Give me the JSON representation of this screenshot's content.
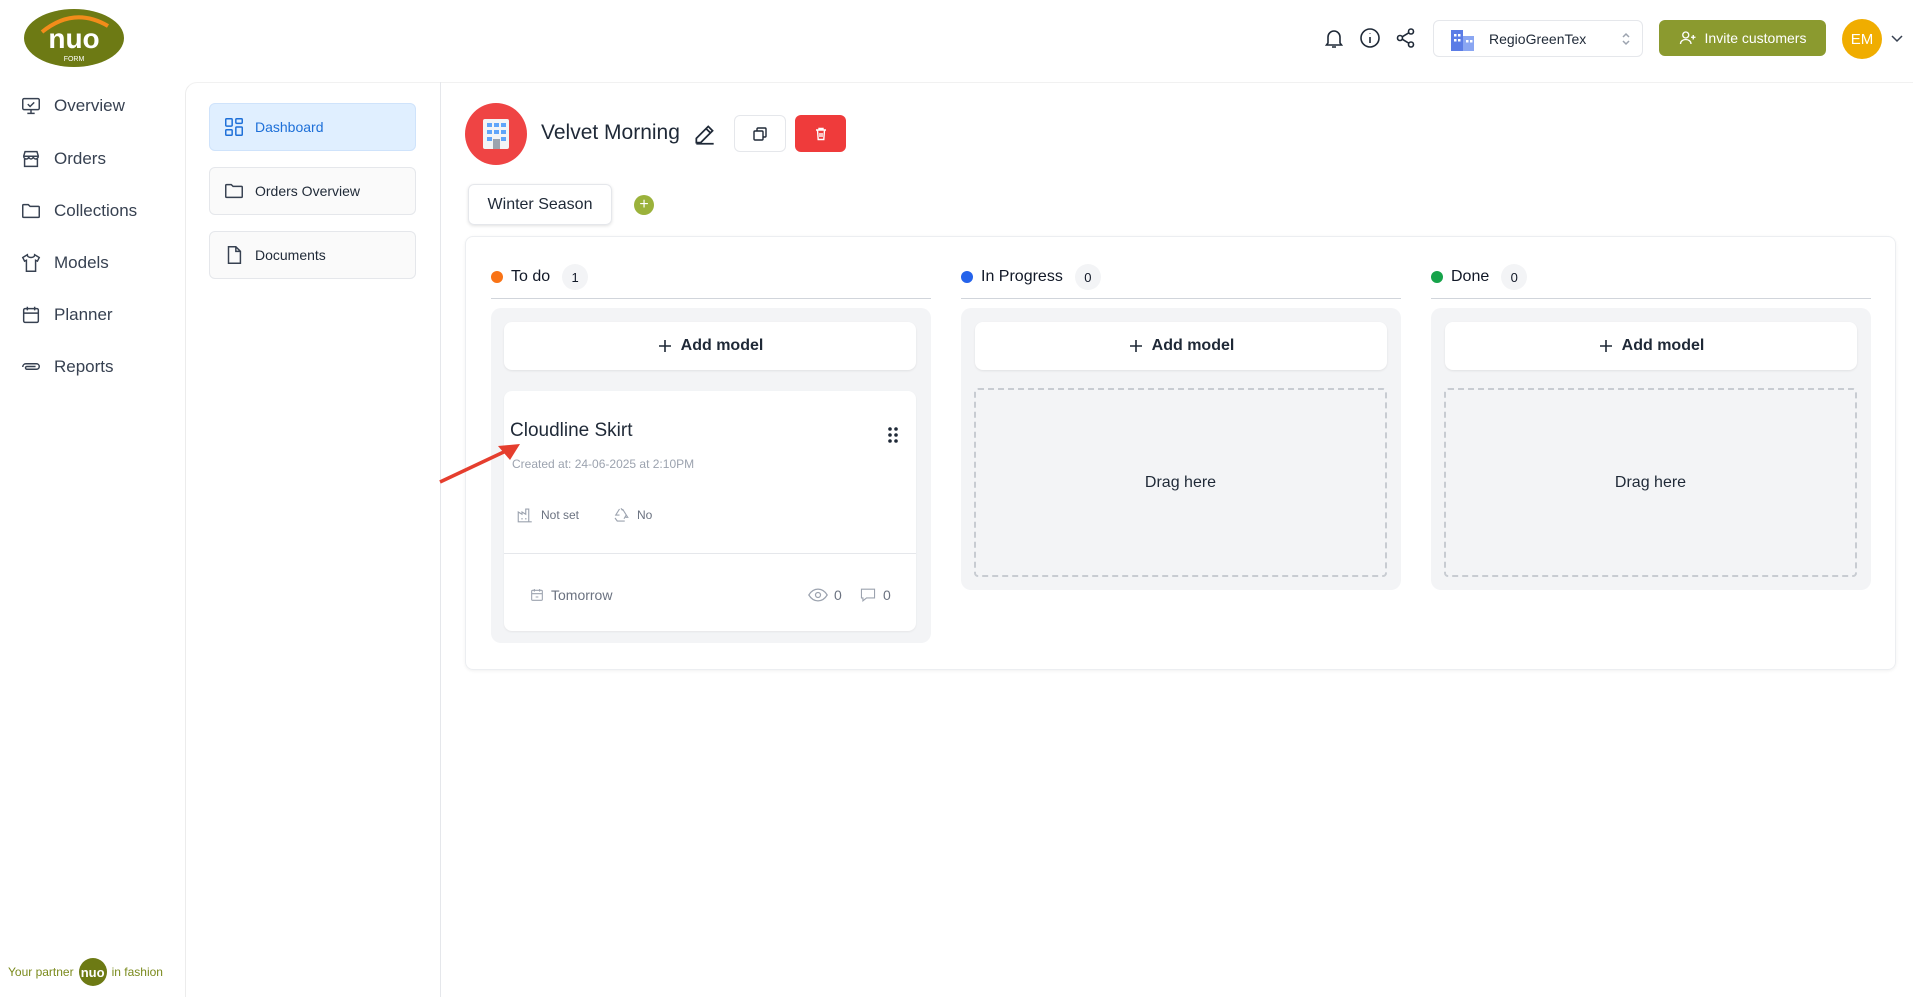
{
  "brand": {
    "logo_text": "nuo",
    "logo_sub": "FORM",
    "partner_prefix": "Your partner",
    "partner_logo": "nuo",
    "partner_suffix": "in fashion"
  },
  "sidebar": {
    "items": [
      {
        "label": "Overview",
        "icon": "monitor-icon"
      },
      {
        "label": "Orders",
        "icon": "store-icon"
      },
      {
        "label": "Collections",
        "icon": "folder-icon"
      },
      {
        "label": "Models",
        "icon": "shirt-icon"
      },
      {
        "label": "Planner",
        "icon": "calendar-icon"
      },
      {
        "label": "Reports",
        "icon": "clip-icon"
      }
    ]
  },
  "subnav": {
    "items": [
      {
        "label": "Dashboard",
        "active": true
      },
      {
        "label": "Orders Overview",
        "active": false
      },
      {
        "label": "Documents",
        "active": false
      }
    ]
  },
  "topbar": {
    "org_name": "RegioGreenTex",
    "invite_label": "Invite customers",
    "avatar_initials": "EM"
  },
  "board": {
    "title": "Velvet Morning",
    "season_tab": "Winter Season",
    "add_season_glyph": "+"
  },
  "columns": [
    {
      "title": "To do",
      "count": "1",
      "color": "#f97316",
      "add_label": "Add model"
    },
    {
      "title": "In Progress",
      "count": "0",
      "color": "#2563eb",
      "add_label": "Add model",
      "drop_label": "Drag here"
    },
    {
      "title": "Done",
      "count": "0",
      "color": "#16a34a",
      "add_label": "Add model",
      "drop_label": "Drag here"
    }
  ],
  "card": {
    "title": "Cloudline Skirt",
    "created": "Created at: 24-06-2025 at 2:10PM",
    "supplier": "Not set",
    "sustainable": "No",
    "due": "Tomorrow",
    "views": "0",
    "comments": "0"
  },
  "colors": {
    "brand_green": "#8b9a2f",
    "danger": "#ef3b3b",
    "avatar": "#f0ad00",
    "active_bg": "#e0efff"
  }
}
